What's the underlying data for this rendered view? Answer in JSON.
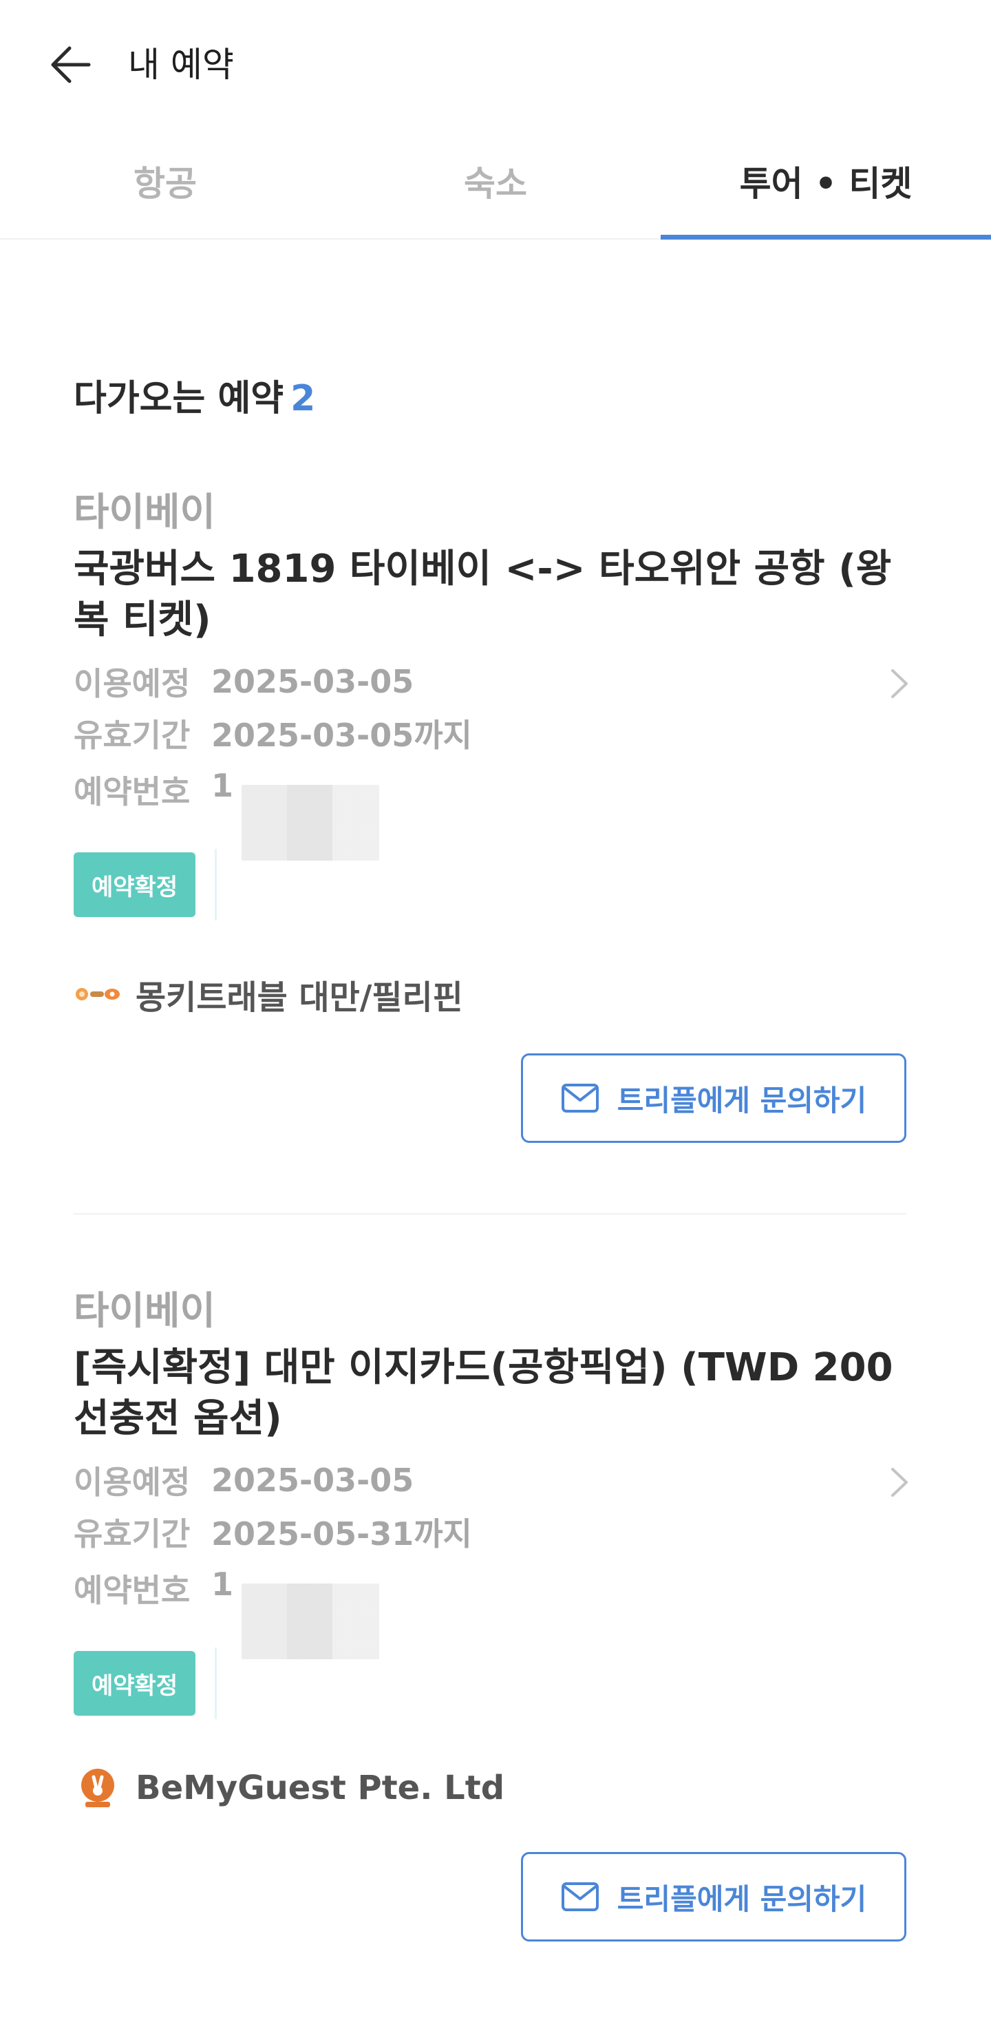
{
  "header": {
    "title": "내 예약"
  },
  "tabs": [
    {
      "label": "항공",
      "active": false
    },
    {
      "label": "숙소",
      "active": false
    },
    {
      "label": "투어 • 티켓",
      "active": true
    }
  ],
  "section": {
    "title": "다가오는 예약",
    "count": "2"
  },
  "labels": {
    "use_date": "이용예정",
    "valid_until": "유효기간",
    "booking_no": "예약번호"
  },
  "reservations": [
    {
      "city": "타이베이",
      "product": "국광버스 1819 타이베이 <-> 타오위안 공항 (왕복 티켓)",
      "use_date": "2025-03-05",
      "valid_until": "2025-03-05까지",
      "booking_no": "1",
      "status": "예약확정",
      "vendor": "몽키트래블 대만/필리핀",
      "contact_label": "트리플에게 문의하기"
    },
    {
      "city": "타이베이",
      "product": "[즉시확정] 대만 이지카드(공항픽업) (TWD 200 선충전 옵션)",
      "use_date": "2025-03-05",
      "valid_until": "2025-05-31까지",
      "booking_no": "1",
      "status": "예약확정",
      "vendor": "BeMyGuest Pte. Ltd",
      "contact_label": "트리플에게 문의하기"
    }
  ],
  "colors": {
    "accent": "#4a86d8",
    "status": "#5ecbbf",
    "muted": "#a6a6a6"
  },
  "icons": {
    "back": "arrow-left-icon",
    "chevron": "chevron-right-icon",
    "mail": "mail-icon"
  }
}
